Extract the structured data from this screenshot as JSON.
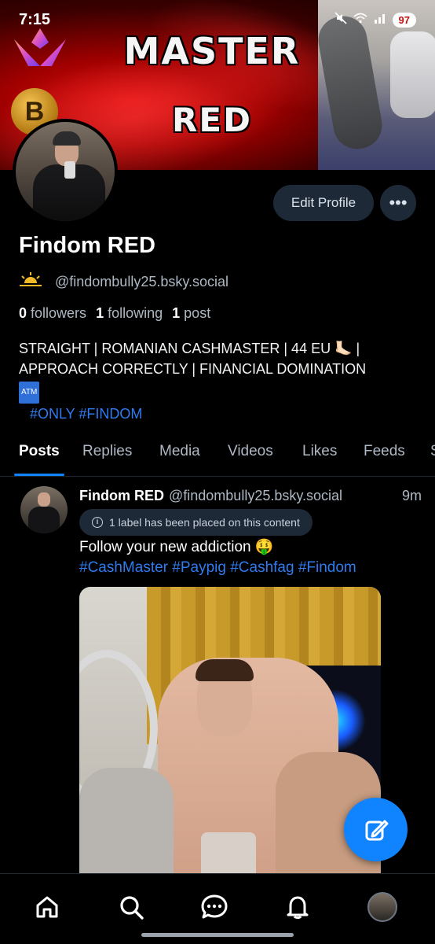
{
  "status_bar": {
    "time": "7:15",
    "battery": "97"
  },
  "banner": {
    "title_line1": "MASTER",
    "title_line2": "RED",
    "coin_letter": "B"
  },
  "profile": {
    "edit_label": "Edit Profile",
    "more_label": "•••",
    "display_name": "Findom RED",
    "handle": "@findombully25.bsky.social",
    "followers_count": "0",
    "followers_label": "followers",
    "following_count": "1",
    "following_label": "following",
    "posts_count": "1",
    "posts_label": "post",
    "bio_line1": "STRAIGHT | ROMANIAN CASHMASTER | 44 EU 🦶🏻 |",
    "bio_line2": "APPROACH CORRECTLY | FINANCIAL DOMINATION",
    "bio_atm": "ATM",
    "bio_tags": "#ONLY #FINDOM"
  },
  "tabs": [
    {
      "label": "Posts"
    },
    {
      "label": "Replies"
    },
    {
      "label": "Media"
    },
    {
      "label": "Videos"
    },
    {
      "label": "Likes"
    },
    {
      "label": "Feeds"
    },
    {
      "label": "S"
    }
  ],
  "post": {
    "author": "Findom RED",
    "handle": "@findombully25.bsky.social",
    "time": "9m",
    "label_text": "1 label has been placed on this content",
    "text": "Follow your new addiction 🤑",
    "tags": "#CashMaster #Paypig #Cashfag #Findom"
  },
  "colors": {
    "accent": "#1083fe",
    "link": "#2f7bf0",
    "pill_bg": "#1e2937",
    "muted_text": "#aeb8c4"
  },
  "icons": {
    "nav": [
      "home-icon",
      "search-icon",
      "chat-icon",
      "bell-icon",
      "profile-avatar"
    ],
    "fab": "compose-icon"
  }
}
